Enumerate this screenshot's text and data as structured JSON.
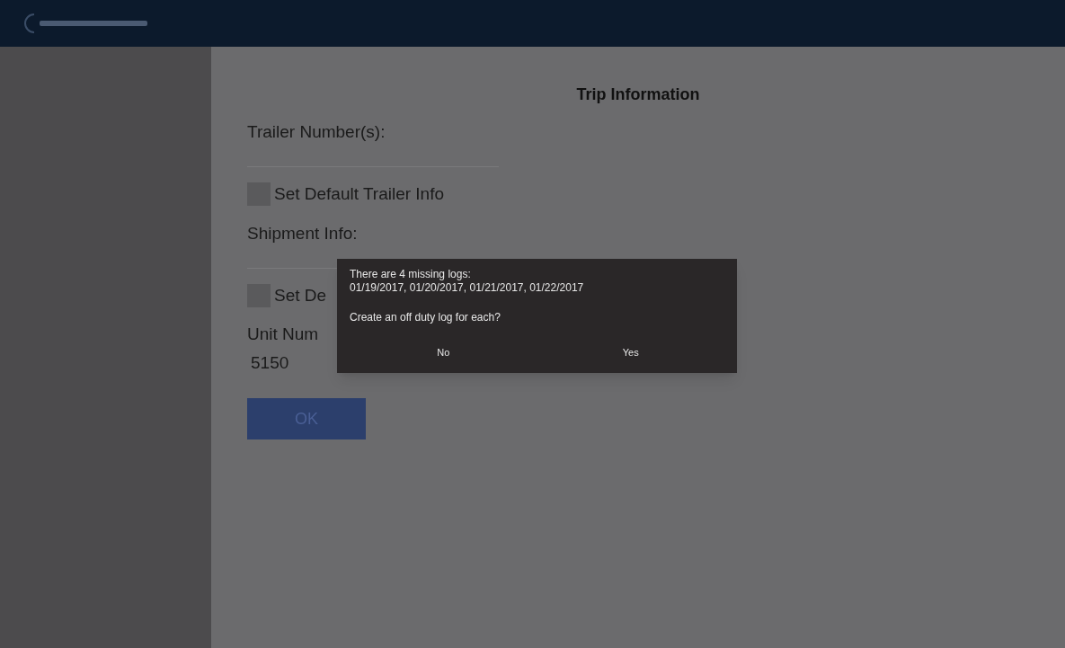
{
  "page": {
    "title": "Trip Information"
  },
  "form": [
    {
      "kind": "label",
      "text": "Trailer Number(s):"
    },
    {
      "kind": "field"
    },
    {
      "kind": "checkbox",
      "text": "Set Default Trailer Info",
      "checked": false
    },
    {
      "kind": "label",
      "text": "Shipment Info:"
    },
    {
      "kind": "field"
    },
    {
      "kind": "checkbox",
      "text": "Set De",
      "checked": false
    },
    {
      "kind": "label",
      "text": "Unit Num"
    },
    {
      "kind": "value",
      "text": "5150"
    }
  ],
  "ok_button": {
    "label": "OK"
  },
  "dialog": {
    "message_lines": [
      "There are 4 missing logs:",
      "01/19/2017, 01/20/2017, 01/21/2017, 01/22/2017"
    ],
    "question": "Create an off duty log for each?",
    "buttons": [
      "No",
      "Yes"
    ]
  }
}
